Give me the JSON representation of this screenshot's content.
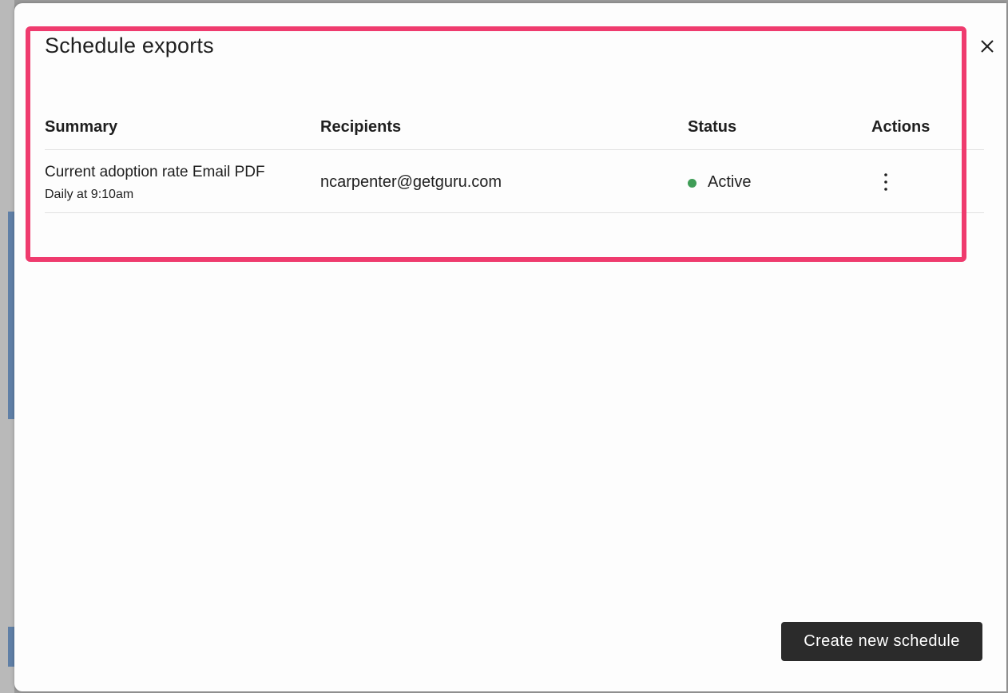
{
  "modal": {
    "title": "Schedule exports",
    "close_icon": "close-icon"
  },
  "table": {
    "columns": [
      "Summary",
      "Recipients",
      "Status",
      "Actions"
    ],
    "rows": [
      {
        "summary": "Current adoption rate Email PDF",
        "frequency": "Daily at 9:10am",
        "recipients": "ncarpenter@getguru.com",
        "status": "Active",
        "status_color": "#3f9d57",
        "actions_icon": "more-vertical-icon"
      }
    ]
  },
  "footer": {
    "create_label": "Create new schedule"
  },
  "colors": {
    "highlight": "#ef3b6e",
    "primary_button": "#2b2b2b"
  }
}
